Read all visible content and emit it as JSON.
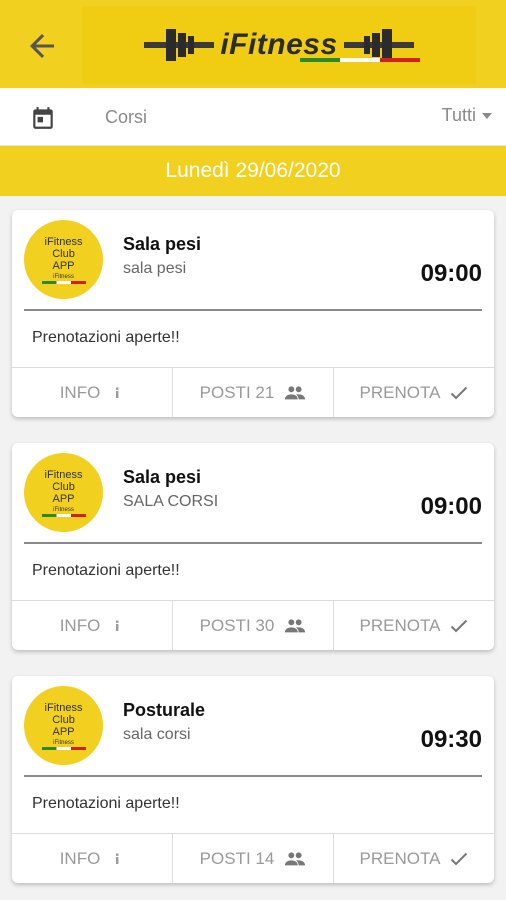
{
  "header": {
    "logo_text": "iFitness",
    "back_icon": "arrow-back-icon",
    "flag_colors": [
      "#2a8a2a",
      "#ffffff",
      "#d02020"
    ]
  },
  "filter": {
    "calendar_icon": "calendar-icon",
    "label": "Corsi",
    "selected": "Tutti"
  },
  "date_label": "Lunedì 29/06/2020",
  "avatar": {
    "line1": "iFitness",
    "line2": "Club",
    "line3": "APP",
    "line4": "iFitness"
  },
  "courses": [
    {
      "title": "Sala pesi",
      "room": "sala pesi",
      "time": "09:00",
      "note": "Prenotazioni aperte!!",
      "info_label": "INFO",
      "posti_label": "POSTI 21",
      "book_label": "PRENOTA"
    },
    {
      "title": "Sala pesi",
      "room": "SALA CORSI",
      "time": "09:00",
      "note": "Prenotazioni aperte!!",
      "info_label": "INFO",
      "posti_label": "POSTI 30",
      "book_label": "PRENOTA"
    },
    {
      "title": "Posturale",
      "room": "sala corsi",
      "time": "09:30",
      "note": "Prenotazioni aperte!!",
      "info_label": "INFO",
      "posti_label": "POSTI 14",
      "book_label": "PRENOTA"
    }
  ],
  "colors": {
    "accent": "#f2d01f",
    "background": "#f2f2f2",
    "muted_text": "#9a9a9a"
  }
}
